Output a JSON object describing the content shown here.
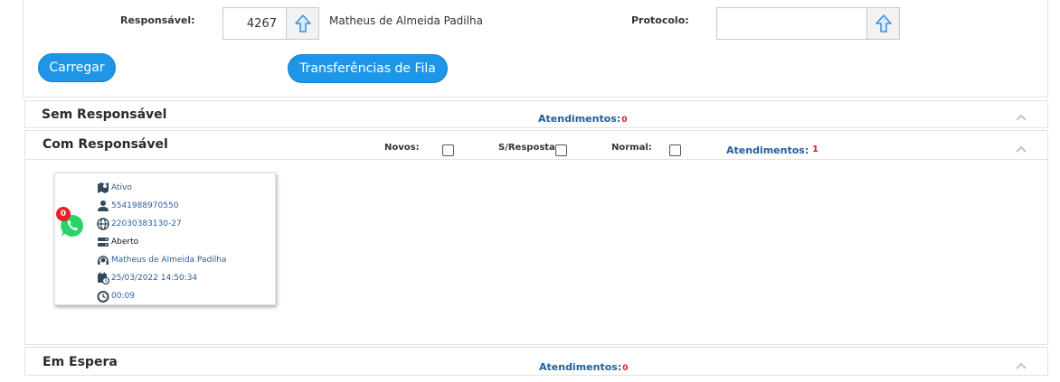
{
  "filters": {
    "responsavel_label": "Responsável:",
    "responsavel_value": "4267",
    "responsavel_name": "Matheus de Almeida Padilha",
    "protocolo_label": "Protocolo:",
    "protocolo_value": "",
    "load_button": "Carregar",
    "transfer_button": "Transferências de Fila"
  },
  "sections": {
    "sem": {
      "title": "Sem Responsável",
      "atendimentos_label": "Atendimentos:",
      "count": "0"
    },
    "com": {
      "title": "Com Responsável",
      "novos_label": "Novos:",
      "sresposta_label": "S/Resposta:",
      "normal_label": "Normal:",
      "atendimentos_label": "Atendimentos:",
      "count": "1"
    },
    "espera": {
      "title": "Em Espera",
      "atendimentos_label": "Atendimentos:",
      "count": "0"
    }
  },
  "card": {
    "badge": "0",
    "channel_icon": "whatsapp-icon",
    "status": "Ativo",
    "phone": "5541988970550",
    "protocol": "22030383130-27",
    "state": "Aberto",
    "agent": "Matheus de Almeida Padilha",
    "datetime": "25/03/2022 14:50:34",
    "duration": "00:09"
  },
  "colors": {
    "accent": "#1e96e8",
    "link": "#1f5f99",
    "count_red": "#e01818",
    "whatsapp": "#25d366"
  }
}
